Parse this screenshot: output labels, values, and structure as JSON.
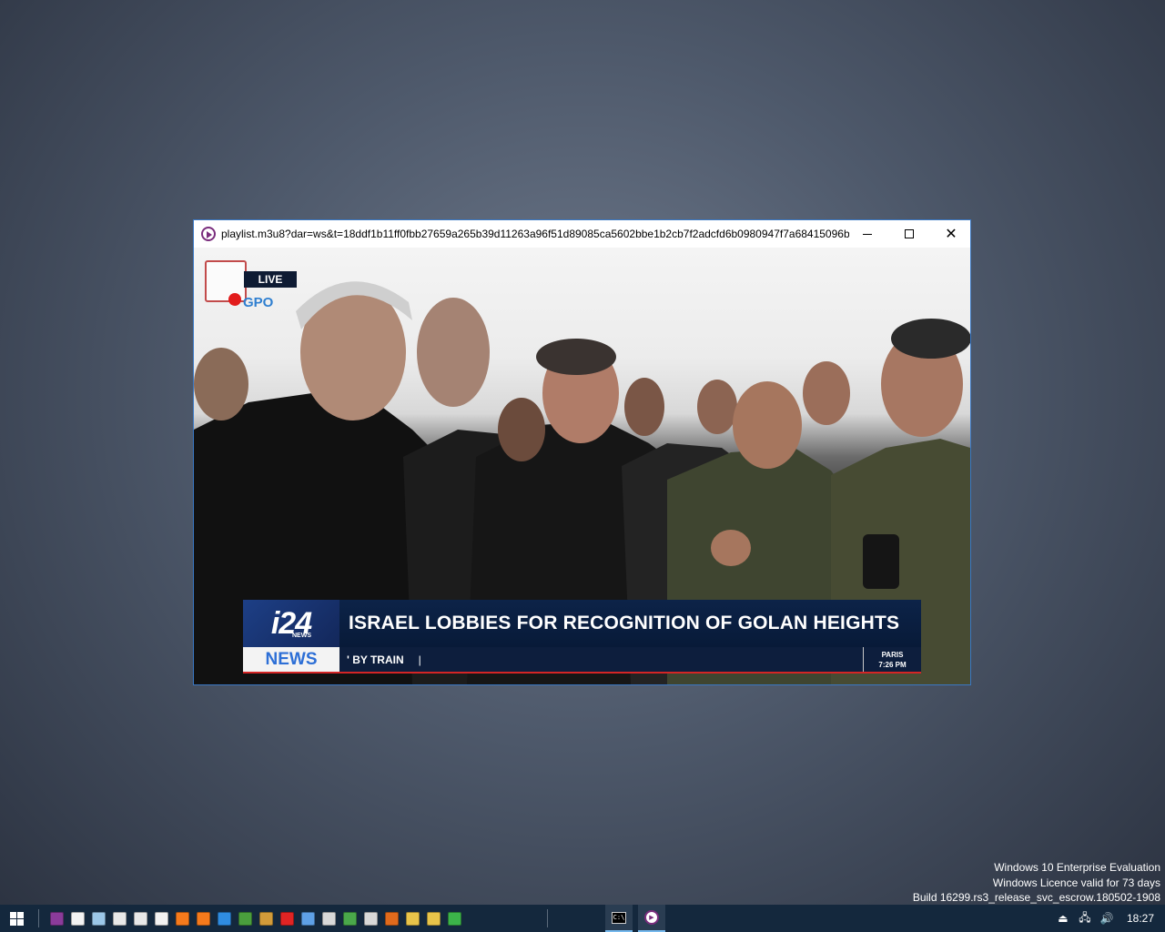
{
  "window": {
    "title": "playlist.m3u8?dar=ws&t=18ddf1b11ff0fbb27659a265b39d11263a96f51d89085ca5602bbe1b2cb7f2adcfd6b0980947f7a68415096bb...",
    "minimize_glyph": "",
    "close_glyph": "✕"
  },
  "video": {
    "live_label": "LIVE",
    "gpo_label": "GPO",
    "brand_num": "i24",
    "brand_sub": "NEWS",
    "headline": "ISRAEL LOBBIES FOR RECOGNITION OF GOLAN HEIGHTS",
    "news_tab": "NEWS",
    "ticker_text": "' BY TRAIN",
    "ticker_sep": "|",
    "clock_city": "PARIS",
    "clock_time": "7:26 PM"
  },
  "watermark": {
    "line1": "Windows 10 Enterprise Evaluation",
    "line2": "Windows Licence valid for 73 days",
    "line3": "Build 16299.rs3_release_svc_escrow.180502-1908"
  },
  "taskbar": {
    "pinned_icons": [
      {
        "name": "vlc-icon",
        "color": "#8a3b9a"
      },
      {
        "name": "notepad-icon",
        "color": "#f2f2f2"
      },
      {
        "name": "recycle-bin-icon",
        "color": "#9bc7e8"
      },
      {
        "name": "cleaner-icon",
        "color": "#e8e8e8"
      },
      {
        "name": "cleaner-alt-icon",
        "color": "#e8e8e8"
      },
      {
        "name": "document-icon",
        "color": "#f2f2f2"
      },
      {
        "name": "firefox-icon",
        "color": "#f57a1c"
      },
      {
        "name": "firefox-dev-icon",
        "color": "#f57a1c"
      },
      {
        "name": "internet-explorer-icon",
        "color": "#2f8ce0"
      },
      {
        "name": "chrome-icon",
        "color": "#4a9e3d"
      },
      {
        "name": "tool-icon",
        "color": "#d29b3a"
      },
      {
        "name": "block-icon",
        "color": "#e02424"
      },
      {
        "name": "network-icon",
        "color": "#5ea0e6"
      },
      {
        "name": "settings-gear-icon",
        "color": "#d8d8d8"
      },
      {
        "name": "refresh-icon",
        "color": "#4aa84a"
      },
      {
        "name": "transfer-icon",
        "color": "#d8d8d8"
      },
      {
        "name": "fox-icon",
        "color": "#e06a1c"
      },
      {
        "name": "key-icon",
        "color": "#e8c44a"
      },
      {
        "name": "folder-icon",
        "color": "#e8c44a"
      },
      {
        "name": "forward-arrow-icon",
        "color": "#3cb34a"
      }
    ],
    "tasks": [
      {
        "name": "command-prompt-task",
        "label": "C:\\"
      },
      {
        "name": "vlc-task",
        "label": "▶"
      }
    ],
    "time": "18:27"
  }
}
